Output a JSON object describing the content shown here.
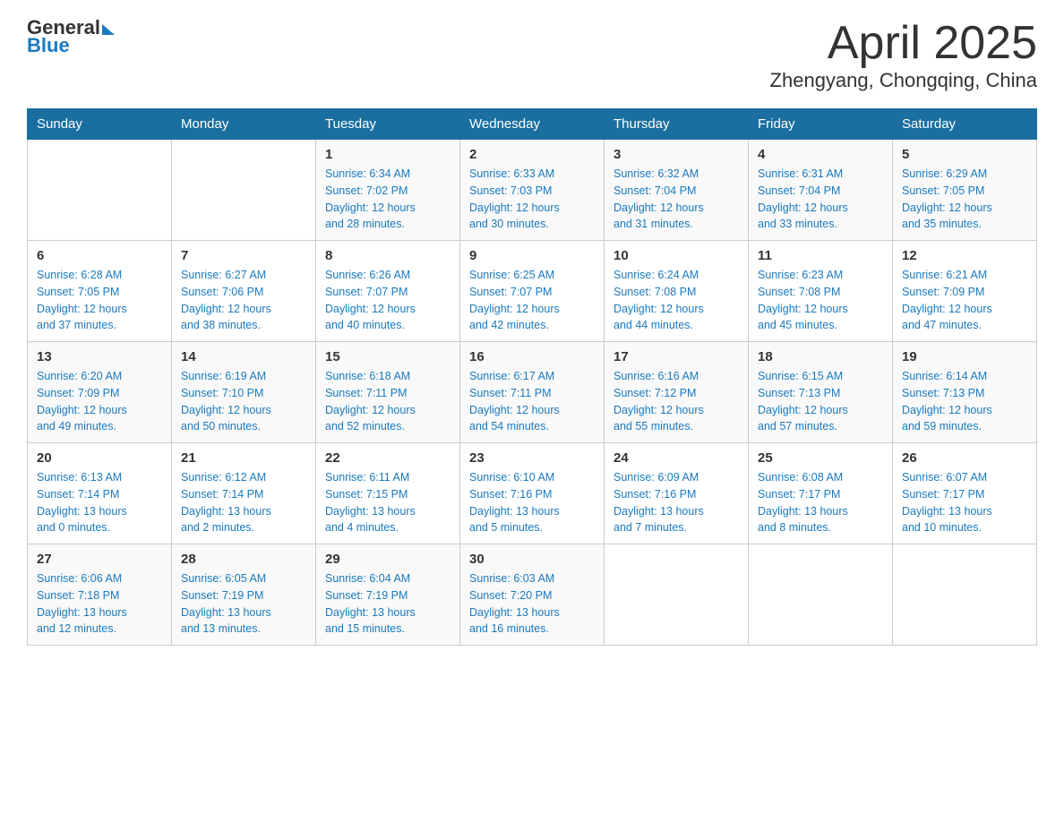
{
  "header": {
    "logo_general": "General",
    "logo_blue": "Blue",
    "title": "April 2025",
    "subtitle": "Zhengyang, Chongqing, China"
  },
  "weekdays": [
    "Sunday",
    "Monday",
    "Tuesday",
    "Wednesday",
    "Thursday",
    "Friday",
    "Saturday"
  ],
  "weeks": [
    [
      {
        "day": "",
        "info": ""
      },
      {
        "day": "",
        "info": ""
      },
      {
        "day": "1",
        "info": "Sunrise: 6:34 AM\nSunset: 7:02 PM\nDaylight: 12 hours\nand 28 minutes."
      },
      {
        "day": "2",
        "info": "Sunrise: 6:33 AM\nSunset: 7:03 PM\nDaylight: 12 hours\nand 30 minutes."
      },
      {
        "day": "3",
        "info": "Sunrise: 6:32 AM\nSunset: 7:04 PM\nDaylight: 12 hours\nand 31 minutes."
      },
      {
        "day": "4",
        "info": "Sunrise: 6:31 AM\nSunset: 7:04 PM\nDaylight: 12 hours\nand 33 minutes."
      },
      {
        "day": "5",
        "info": "Sunrise: 6:29 AM\nSunset: 7:05 PM\nDaylight: 12 hours\nand 35 minutes."
      }
    ],
    [
      {
        "day": "6",
        "info": "Sunrise: 6:28 AM\nSunset: 7:05 PM\nDaylight: 12 hours\nand 37 minutes."
      },
      {
        "day": "7",
        "info": "Sunrise: 6:27 AM\nSunset: 7:06 PM\nDaylight: 12 hours\nand 38 minutes."
      },
      {
        "day": "8",
        "info": "Sunrise: 6:26 AM\nSunset: 7:07 PM\nDaylight: 12 hours\nand 40 minutes."
      },
      {
        "day": "9",
        "info": "Sunrise: 6:25 AM\nSunset: 7:07 PM\nDaylight: 12 hours\nand 42 minutes."
      },
      {
        "day": "10",
        "info": "Sunrise: 6:24 AM\nSunset: 7:08 PM\nDaylight: 12 hours\nand 44 minutes."
      },
      {
        "day": "11",
        "info": "Sunrise: 6:23 AM\nSunset: 7:08 PM\nDaylight: 12 hours\nand 45 minutes."
      },
      {
        "day": "12",
        "info": "Sunrise: 6:21 AM\nSunset: 7:09 PM\nDaylight: 12 hours\nand 47 minutes."
      }
    ],
    [
      {
        "day": "13",
        "info": "Sunrise: 6:20 AM\nSunset: 7:09 PM\nDaylight: 12 hours\nand 49 minutes."
      },
      {
        "day": "14",
        "info": "Sunrise: 6:19 AM\nSunset: 7:10 PM\nDaylight: 12 hours\nand 50 minutes."
      },
      {
        "day": "15",
        "info": "Sunrise: 6:18 AM\nSunset: 7:11 PM\nDaylight: 12 hours\nand 52 minutes."
      },
      {
        "day": "16",
        "info": "Sunrise: 6:17 AM\nSunset: 7:11 PM\nDaylight: 12 hours\nand 54 minutes."
      },
      {
        "day": "17",
        "info": "Sunrise: 6:16 AM\nSunset: 7:12 PM\nDaylight: 12 hours\nand 55 minutes."
      },
      {
        "day": "18",
        "info": "Sunrise: 6:15 AM\nSunset: 7:13 PM\nDaylight: 12 hours\nand 57 minutes."
      },
      {
        "day": "19",
        "info": "Sunrise: 6:14 AM\nSunset: 7:13 PM\nDaylight: 12 hours\nand 59 minutes."
      }
    ],
    [
      {
        "day": "20",
        "info": "Sunrise: 6:13 AM\nSunset: 7:14 PM\nDaylight: 13 hours\nand 0 minutes."
      },
      {
        "day": "21",
        "info": "Sunrise: 6:12 AM\nSunset: 7:14 PM\nDaylight: 13 hours\nand 2 minutes."
      },
      {
        "day": "22",
        "info": "Sunrise: 6:11 AM\nSunset: 7:15 PM\nDaylight: 13 hours\nand 4 minutes."
      },
      {
        "day": "23",
        "info": "Sunrise: 6:10 AM\nSunset: 7:16 PM\nDaylight: 13 hours\nand 5 minutes."
      },
      {
        "day": "24",
        "info": "Sunrise: 6:09 AM\nSunset: 7:16 PM\nDaylight: 13 hours\nand 7 minutes."
      },
      {
        "day": "25",
        "info": "Sunrise: 6:08 AM\nSunset: 7:17 PM\nDaylight: 13 hours\nand 8 minutes."
      },
      {
        "day": "26",
        "info": "Sunrise: 6:07 AM\nSunset: 7:17 PM\nDaylight: 13 hours\nand 10 minutes."
      }
    ],
    [
      {
        "day": "27",
        "info": "Sunrise: 6:06 AM\nSunset: 7:18 PM\nDaylight: 13 hours\nand 12 minutes."
      },
      {
        "day": "28",
        "info": "Sunrise: 6:05 AM\nSunset: 7:19 PM\nDaylight: 13 hours\nand 13 minutes."
      },
      {
        "day": "29",
        "info": "Sunrise: 6:04 AM\nSunset: 7:19 PM\nDaylight: 13 hours\nand 15 minutes."
      },
      {
        "day": "30",
        "info": "Sunrise: 6:03 AM\nSunset: 7:20 PM\nDaylight: 13 hours\nand 16 minutes."
      },
      {
        "day": "",
        "info": ""
      },
      {
        "day": "",
        "info": ""
      },
      {
        "day": "",
        "info": ""
      }
    ]
  ]
}
